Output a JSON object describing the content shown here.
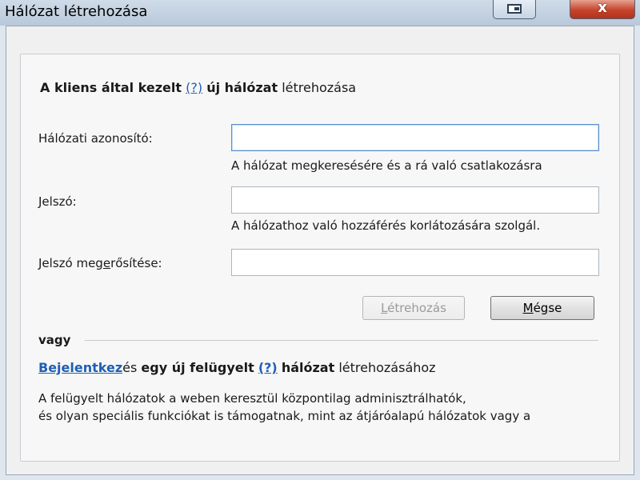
{
  "window": {
    "title": "Hálózat létrehozása",
    "close_label": "x"
  },
  "section1": {
    "heading_part1": "A kliens által kezelt",
    "help_link": "(?)",
    "heading_part2": "új hálózat",
    "heading_part3": "létrehozása"
  },
  "form": {
    "network_id_label": "Hálózati azonosító:",
    "network_id_value": "",
    "network_id_hint": "A hálózat megkeresésére és a rá való csatlakozásra",
    "password_label": "Jelszó:",
    "password_value": "",
    "password_hint": "A hálózathoz való hozzáférés korlátozására szolgál.",
    "confirm_label_pre": "Jelszó meg",
    "confirm_label_access": "e",
    "confirm_label_post": "rősítése:",
    "confirm_value": ""
  },
  "buttons": {
    "create_access": "L",
    "create_rest": "étrehozás",
    "cancel_access": "M",
    "cancel_rest": "égse"
  },
  "section2": {
    "or_label": "vagy",
    "signin_link": "Bejelentkez",
    "signin_suffix": "és",
    "bold_part1": "egy új felügyelt",
    "help_link": "(?)",
    "bold_part2": "hálózat",
    "tail": "létrehozásához",
    "desc_line1": "A felügyelt hálózatok a weben keresztül központilag adminisztrálhatók,",
    "desc_line2": "és olyan speciális funkciókat is támogatnak, mint az átjáróalapú hálózatok vagy a"
  },
  "icons": {
    "restore": "window-restore-icon",
    "close": "close-icon"
  }
}
